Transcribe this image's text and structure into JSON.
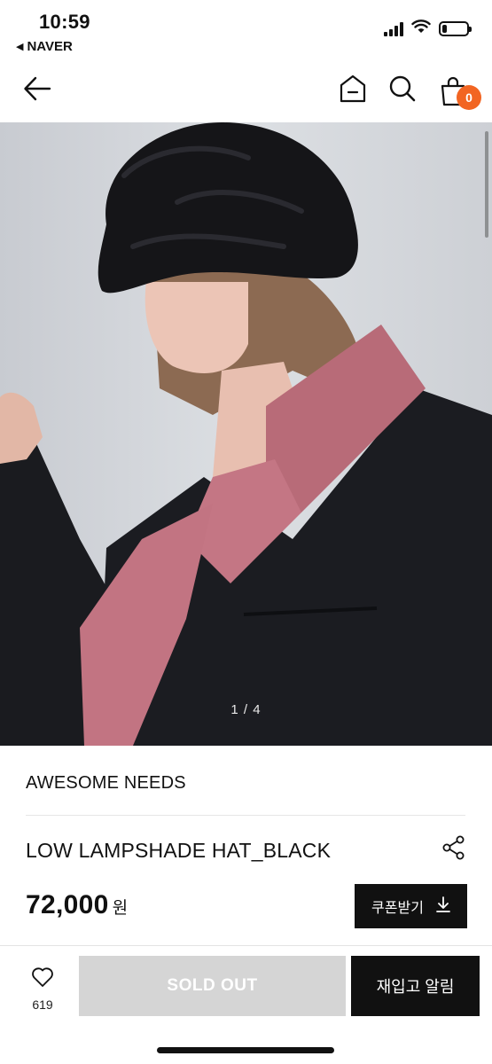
{
  "status_bar": {
    "time": "10:59",
    "back_app": "NAVER",
    "battery_level": 0.2
  },
  "header": {
    "cart_count": "0",
    "badge_color": "#f26522"
  },
  "gallery": {
    "counter": "1 / 4",
    "current": 1,
    "total": 4
  },
  "product": {
    "brand": "AWESOME NEEDS",
    "name": "LOW LAMPSHADE HAT_BLACK",
    "price": "72,000",
    "currency": "원",
    "coupon_label": "쿠폰받기"
  },
  "bottom_bar": {
    "like_count": "619",
    "soldout_label": "SOLD OUT",
    "restock_label": "재입고 알림"
  },
  "icons": {
    "back": "arrow-left-icon",
    "home": "home-icon",
    "search": "search-icon",
    "cart": "shopping-bag-icon",
    "share": "share-icon",
    "download": "download-arrow-icon",
    "like": "heart-icon"
  }
}
